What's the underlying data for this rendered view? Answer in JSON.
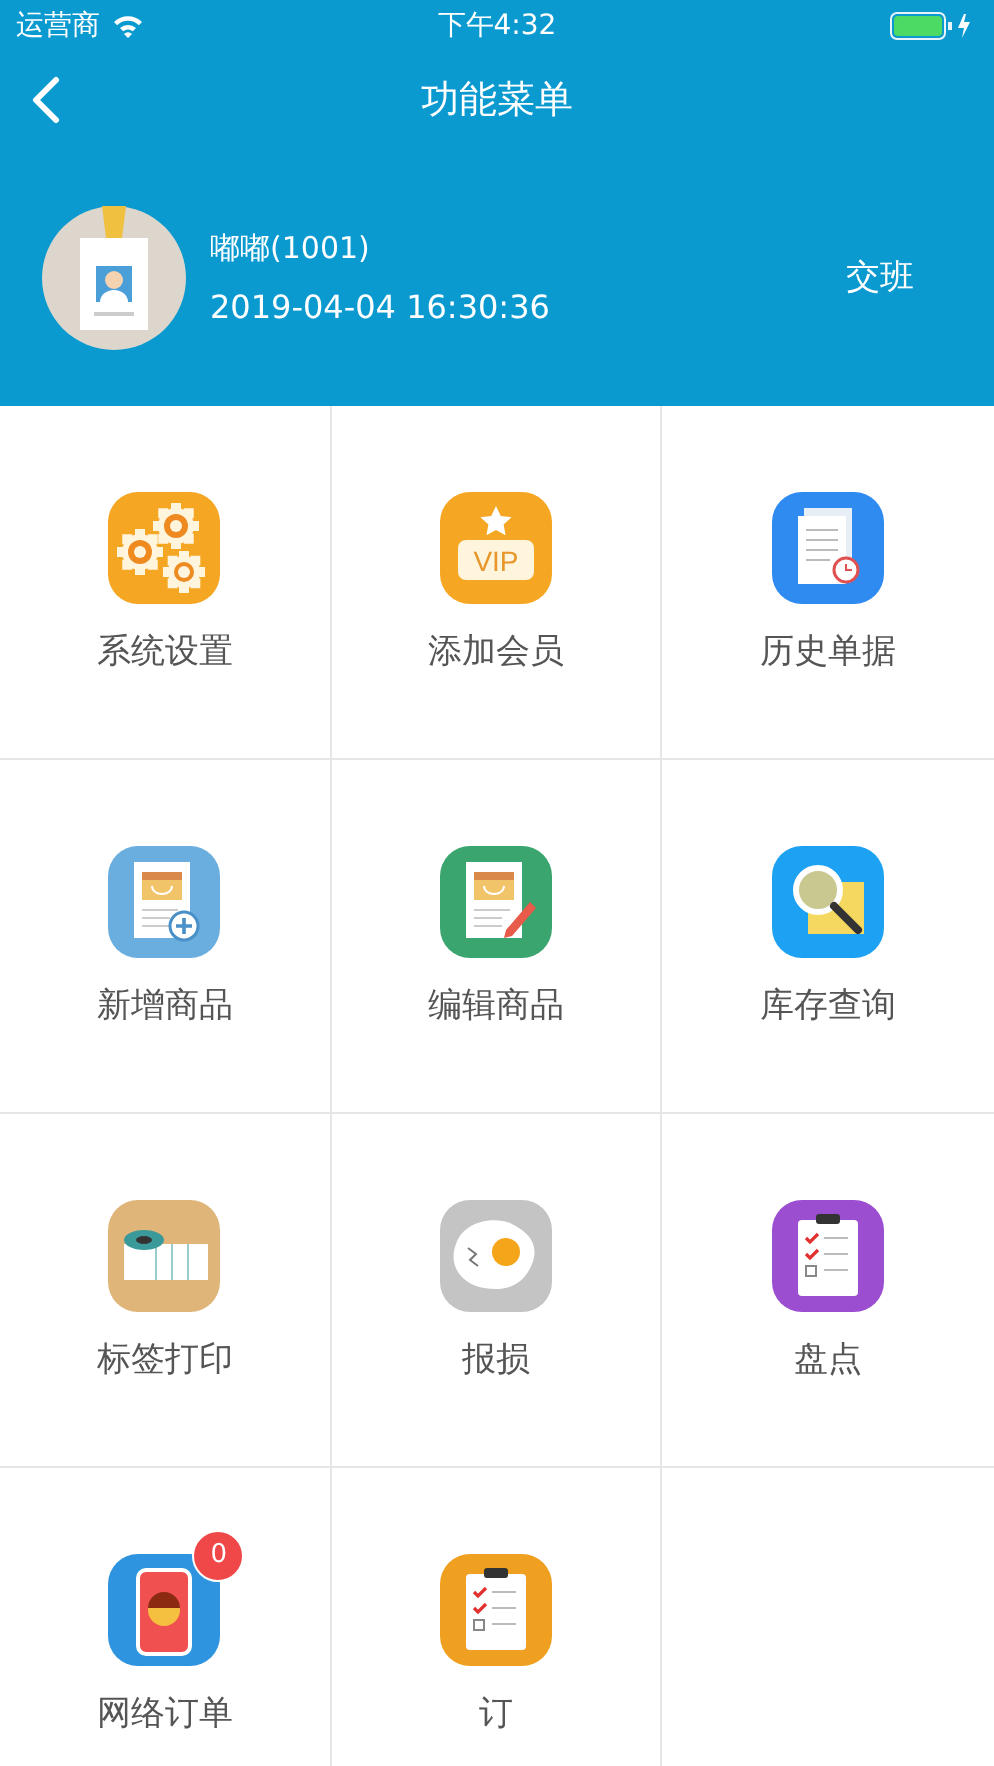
{
  "status_bar": {
    "carrier": "运营商",
    "time": "下午4:32"
  },
  "nav": {
    "title": "功能菜单"
  },
  "profile": {
    "name": "嘟嘟(1001)",
    "datetime": "2019-04-04 16:30:36",
    "action": "交班"
  },
  "menu": [
    {
      "label": "系统设置",
      "kind": "gears"
    },
    {
      "label": "添加会员",
      "kind": "vip",
      "icon_text": "VIP"
    },
    {
      "label": "历史单据",
      "kind": "receipt"
    },
    {
      "label": "新增商品",
      "kind": "add-product"
    },
    {
      "label": "编辑商品",
      "kind": "edit-product"
    },
    {
      "label": "库存查询",
      "kind": "search"
    },
    {
      "label": "标签打印",
      "kind": "label-roll"
    },
    {
      "label": "报损",
      "kind": "egg"
    },
    {
      "label": "盘点",
      "kind": "checklist"
    },
    {
      "label": "网络订单",
      "kind": "phone",
      "badge": "0"
    },
    {
      "label": "订",
      "kind": "order"
    }
  ]
}
